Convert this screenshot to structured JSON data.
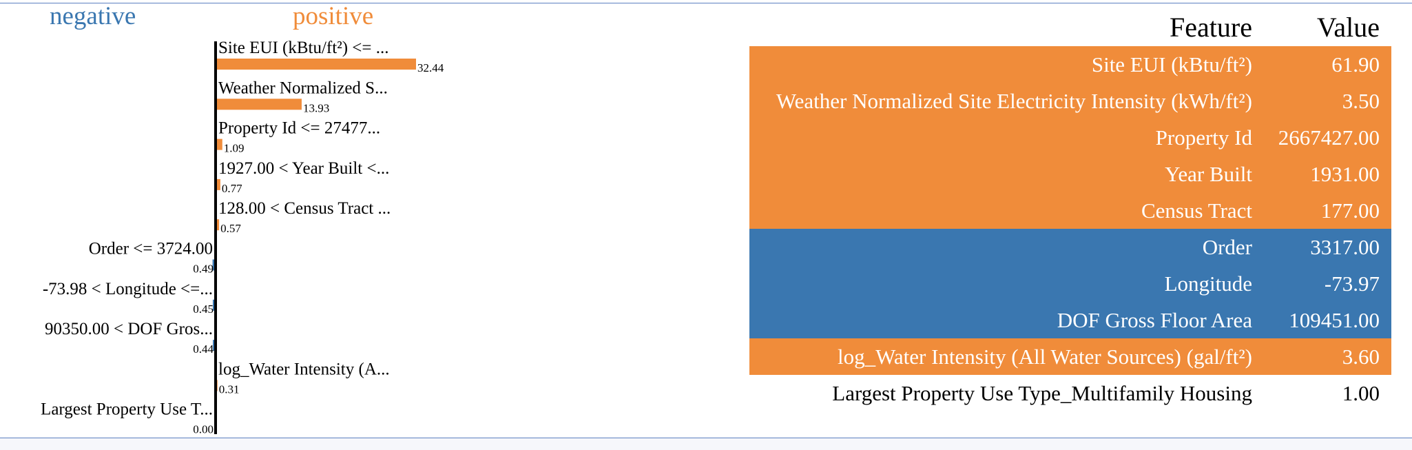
{
  "legend": {
    "negative": "negative",
    "positive": "positive"
  },
  "colors": {
    "positive": "#f08c3a",
    "negative": "#3a77b0",
    "axis": "#000000"
  },
  "chart_data": {
    "type": "bar",
    "orientation": "horizontal",
    "categories": [
      "Site EUI (kBtu/ft²) <= ...",
      "Weather Normalized S...",
      "Property Id <= 27477...",
      "1927.00 < Year Built <...",
      "128.00 < Census Tract ...",
      "Order <= 3724.00",
      "-73.98 < Longitude <=...",
      "90350.00 < DOF Gros...",
      "log_Water Intensity (A...",
      "Largest Property Use T..."
    ],
    "values": [
      32.44,
      13.93,
      1.09,
      0.77,
      0.57,
      0.49,
      0.45,
      0.44,
      0.31,
      0.0
    ],
    "value_labels": [
      "32.44",
      "13.93",
      "1.09",
      "0.77",
      "0.57",
      "0.49",
      "0.45",
      "0.44",
      "0.31",
      "0.00"
    ],
    "direction": [
      "positive",
      "positive",
      "positive",
      "positive",
      "positive",
      "negative",
      "negative",
      "negative",
      "positive",
      "negative"
    ],
    "xlim": [
      0,
      32.44
    ]
  },
  "table": {
    "header": {
      "feature": "Feature",
      "value": "Value"
    },
    "rows": [
      {
        "feature": "Site EUI (kBtu/ft²)",
        "value": "61.90",
        "kind": "positive"
      },
      {
        "feature": "Weather Normalized Site Electricity Intensity (kWh/ft²)",
        "value": "3.50",
        "kind": "positive"
      },
      {
        "feature": "Property Id",
        "value": "2667427.00",
        "kind": "positive"
      },
      {
        "feature": "Year Built",
        "value": "1931.00",
        "kind": "positive"
      },
      {
        "feature": "Census Tract",
        "value": "177.00",
        "kind": "positive"
      },
      {
        "feature": "Order",
        "value": "3317.00",
        "kind": "negative"
      },
      {
        "feature": "Longitude",
        "value": "-73.97",
        "kind": "negative"
      },
      {
        "feature": "DOF Gross Floor Area",
        "value": "109451.00",
        "kind": "negative"
      },
      {
        "feature": "log_Water Intensity (All Water Sources) (gal/ft²)",
        "value": "3.60",
        "kind": "positive"
      },
      {
        "feature": "Largest Property Use Type_Multifamily Housing",
        "value": "1.00",
        "kind": "none"
      }
    ]
  }
}
